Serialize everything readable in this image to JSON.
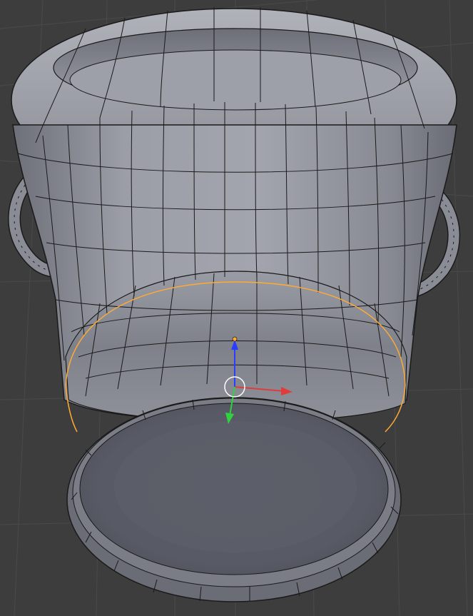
{
  "viewport": {
    "background": "#3d3d3d",
    "grid_color": "#4a4a4a",
    "mesh_fill": "#8e9099",
    "wire_color": "#1a1a1a",
    "selection_color": "#ffaa33"
  },
  "gizmo": {
    "axes": [
      {
        "name": "x",
        "color": "#e23b3b",
        "icon": "arrow-right"
      },
      {
        "name": "y",
        "color": "#2fd23f",
        "icon": "arrow-down"
      },
      {
        "name": "z",
        "color": "#2a3cff",
        "icon": "arrow-up"
      }
    ],
    "pivot_color": "#ffffff"
  }
}
